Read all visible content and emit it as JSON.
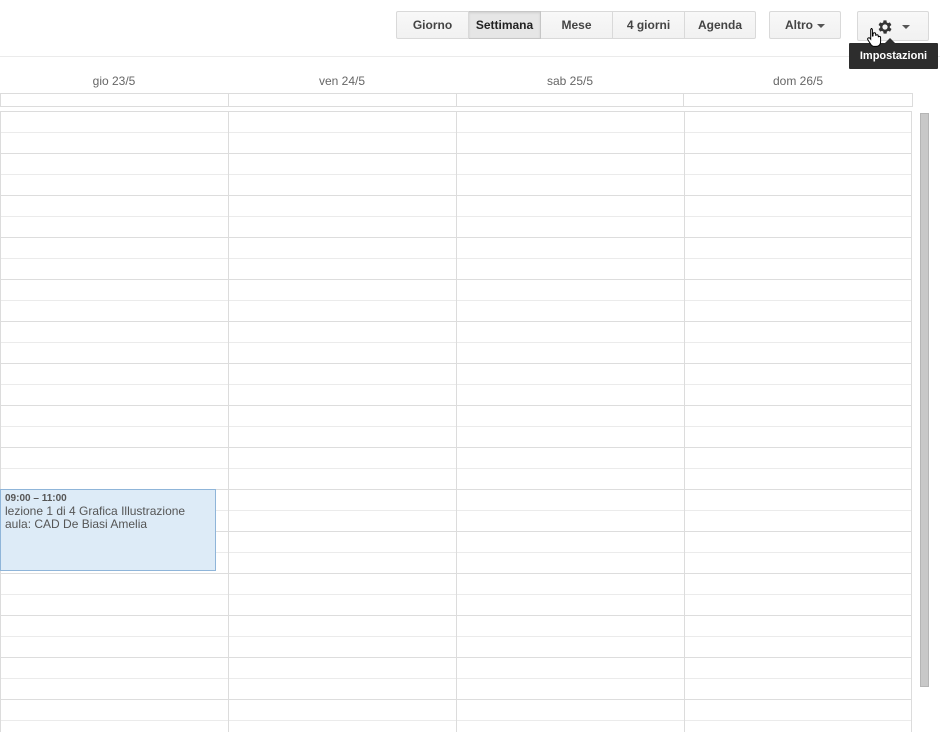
{
  "toolbar": {
    "views": [
      {
        "label": "Giorno",
        "active": false
      },
      {
        "label": "Settimana",
        "active": true
      },
      {
        "label": "Mese",
        "active": false
      },
      {
        "label": "4 giorni",
        "active": false
      },
      {
        "label": "Agenda",
        "active": false
      }
    ],
    "more_label": "Altro",
    "settings_icon": "gear-icon",
    "settings_tooltip": "Impostazioni"
  },
  "days": [
    "gio 23/5",
    "ven 24/5",
    "sab 25/5",
    "dom 26/5"
  ],
  "event": {
    "time": "09:00 – 11:00",
    "title": "lezione 1 di 4 Grafica Illustrazione",
    "location": "aula: CAD De Biasi Amelia",
    "color": "#ddebf7"
  }
}
